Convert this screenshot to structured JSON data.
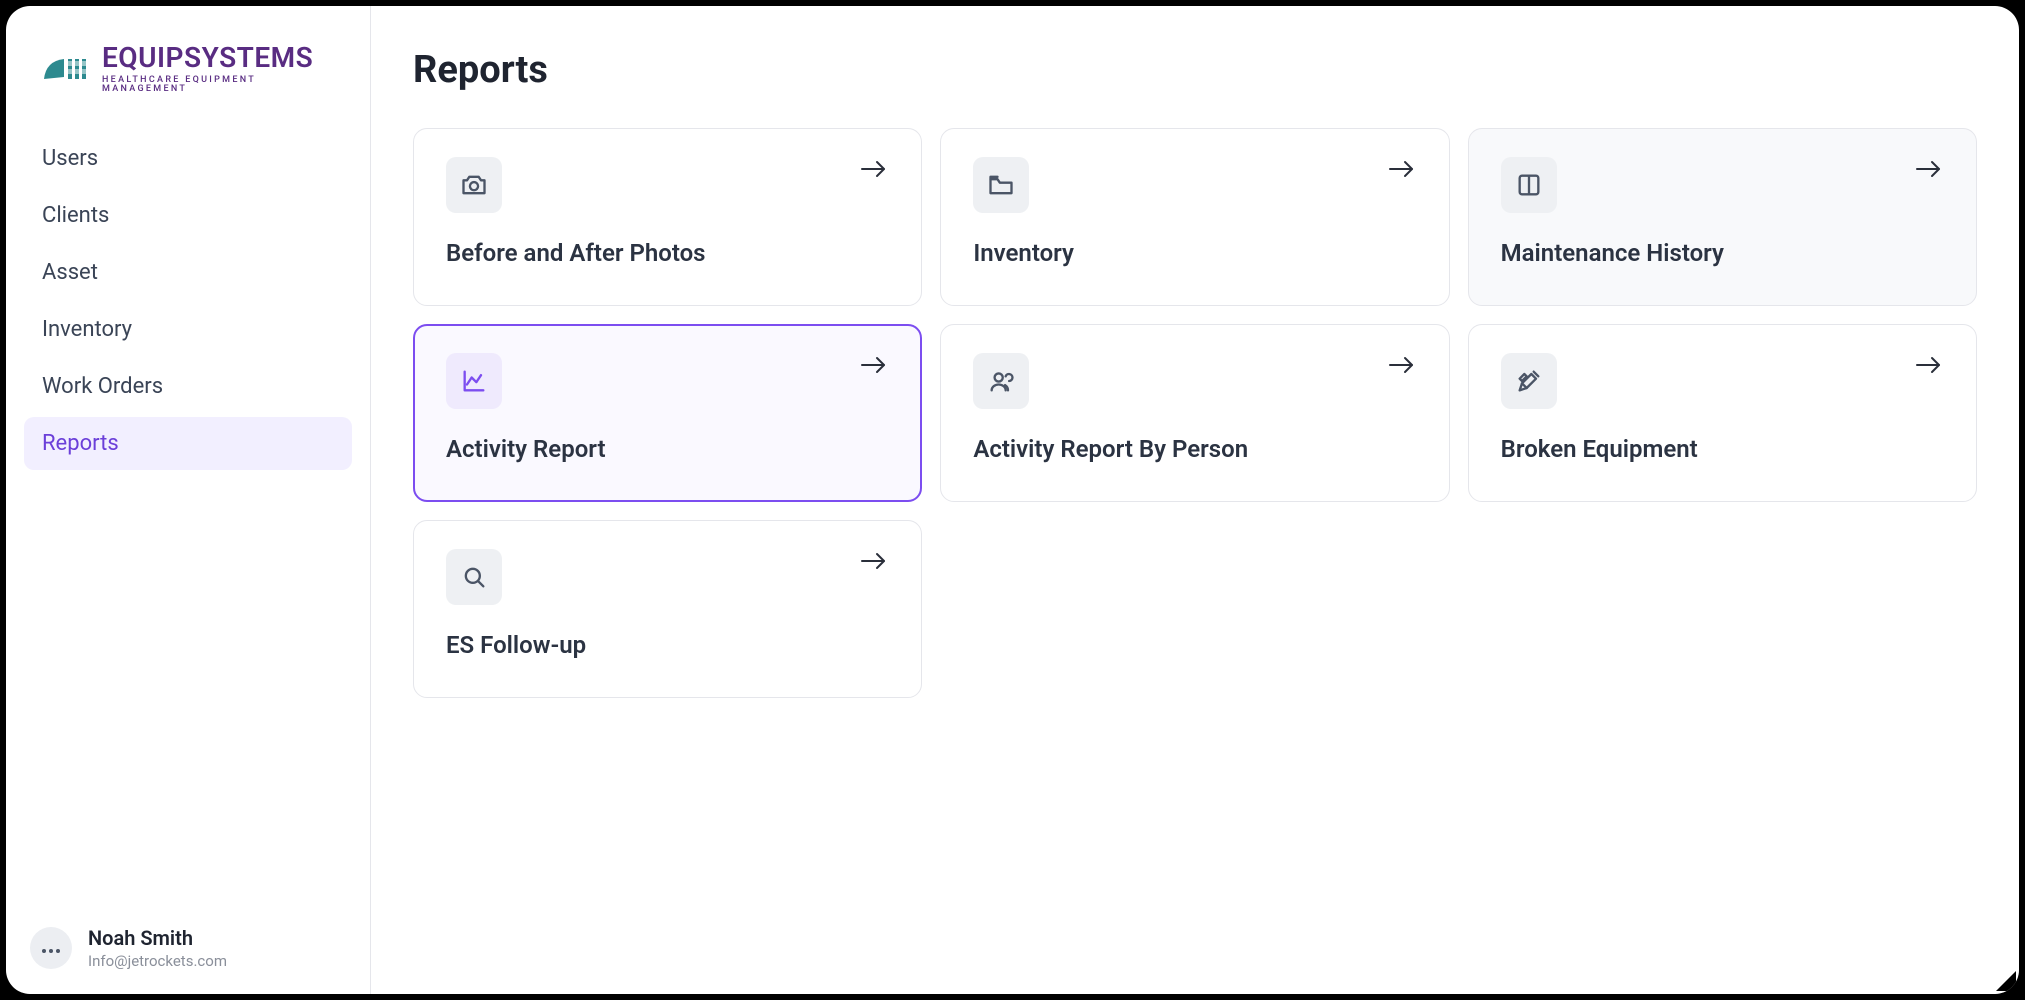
{
  "brand": {
    "name": "EQUIPSYSTEMS",
    "tagline": "HEALTHCARE EQUIPMENT MANAGEMENT",
    "accent_color": "#592c82",
    "mark_color": "#2d8a8f"
  },
  "sidebar": {
    "items": [
      {
        "label": "Users"
      },
      {
        "label": "Clients"
      },
      {
        "label": "Asset"
      },
      {
        "label": "Inventory"
      },
      {
        "label": "Work Orders"
      },
      {
        "label": "Reports",
        "active": true
      }
    ]
  },
  "user": {
    "name": "Noah Smith",
    "email": "Info@jetrockets.com"
  },
  "page": {
    "title": "Reports"
  },
  "reports": [
    {
      "title": "Before and After Photos",
      "icon": "camera-icon",
      "state": "default"
    },
    {
      "title": "Inventory",
      "icon": "folder-icon",
      "state": "default"
    },
    {
      "title": "Maintenance History",
      "icon": "columns-icon",
      "state": "hover"
    },
    {
      "title": "Activity Report",
      "icon": "chart-line-icon",
      "state": "selected"
    },
    {
      "title": "Activity Report By Person",
      "icon": "users-icon",
      "state": "default"
    },
    {
      "title": "Broken Equipment",
      "icon": "tools-icon",
      "state": "default"
    },
    {
      "title": "ES Follow-up",
      "icon": "search-icon",
      "state": "default"
    }
  ],
  "colors": {
    "selection": "#7c4df0",
    "border": "#e5e6eb",
    "text_primary": "#1f2430",
    "text_secondary": "#3a4456",
    "nav_active_bg": "#f2efff"
  }
}
